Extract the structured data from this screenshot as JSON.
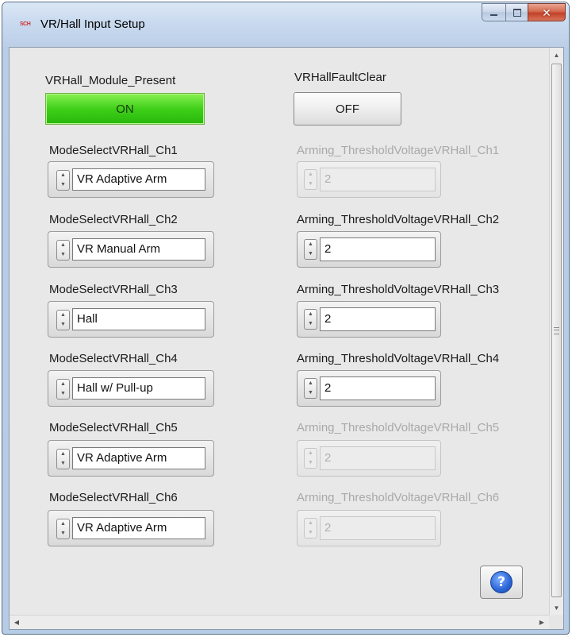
{
  "window": {
    "title": "VR/Hall Input Setup",
    "app_icon_text": "SCH"
  },
  "colors": {
    "led_on": "#3fd019",
    "disabled_text": "#a9a9a9",
    "window_frame": "#bccfe8"
  },
  "module_present": {
    "label": "VRHall_Module_Present",
    "value": "ON"
  },
  "fault_clear": {
    "label": "VRHallFaultClear",
    "value": "OFF"
  },
  "modes": [
    {
      "label": "ModeSelectVRHall_Ch1",
      "value": "VR Adaptive Arm"
    },
    {
      "label": "ModeSelectVRHall_Ch2",
      "value": "VR Manual Arm"
    },
    {
      "label": "ModeSelectVRHall_Ch3",
      "value": "Hall"
    },
    {
      "label": "ModeSelectVRHall_Ch4",
      "value": "Hall w/ Pull-up"
    },
    {
      "label": "ModeSelectVRHall_Ch5",
      "value": "VR Adaptive Arm"
    },
    {
      "label": "ModeSelectVRHall_Ch6",
      "value": "VR Adaptive Arm"
    }
  ],
  "thresholds": [
    {
      "label": "Arming_ThresholdVoltageVRHall_Ch1",
      "value": "2",
      "enabled": false
    },
    {
      "label": "Arming_ThresholdVoltageVRHall_Ch2",
      "value": "2",
      "enabled": true
    },
    {
      "label": "Arming_ThresholdVoltageVRHall_Ch3",
      "value": "2",
      "enabled": true
    },
    {
      "label": "Arming_ThresholdVoltageVRHall_Ch4",
      "value": "2",
      "enabled": true
    },
    {
      "label": "Arming_ThresholdVoltageVRHall_Ch5",
      "value": "2",
      "enabled": false
    },
    {
      "label": "Arming_ThresholdVoltageVRHall_Ch6",
      "value": "2",
      "enabled": false
    }
  ],
  "help": {
    "glyph": "?"
  }
}
